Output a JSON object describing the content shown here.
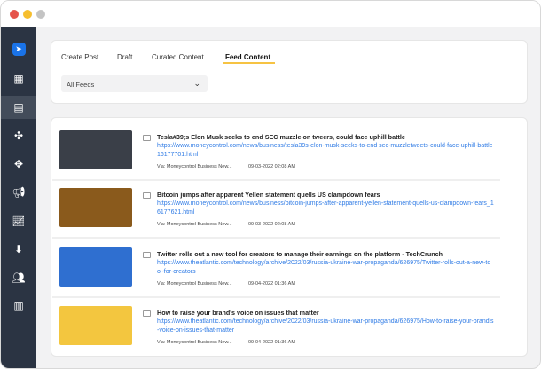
{
  "window": {
    "controls": [
      "close",
      "minimize",
      "maximize"
    ]
  },
  "sidebar": {
    "items": [
      "send-logo",
      "dashboard",
      "posts",
      "network",
      "move",
      "campaign",
      "analytics",
      "inbox",
      "users",
      "library"
    ]
  },
  "tabs": [
    {
      "label": "Create Post"
    },
    {
      "label": "Draft"
    },
    {
      "label": "Curated Content"
    },
    {
      "label": "Feed Content"
    }
  ],
  "filter": {
    "value": "All Feeds"
  },
  "feeds": [
    {
      "title": "Tesla#39;s Elon Musk seeks to end SEC muzzle on tweers, could face uphill battle",
      "url": "https://www.moneycontrol.com/news/business/tesla39s-elon-musk-seeks-to-end sec-muzzletweets-could-face-uphill-battle16177701.html",
      "via": "Via: Moneycontrol Business New...",
      "date": "09-03-2022 02:08 AM",
      "thumb": "#3a3f48"
    },
    {
      "title": "Bitcoin jumps after apparent Yellen statement quells US clampdown fears",
      "url": "https://www.moneycontrol.com/news/business/bitcoin-jumps-after-apparent-yellen-statement-quells-us-clampdown-fears_16177621.html",
      "via": "Via: Moneycontrol Business New...",
      "date": "09-03-2022 02:08 AM",
      "thumb": "#8a5a1c"
    },
    {
      "title": "Twitter rolls out a new tool for creators to manage their earnings on the platform - TechCrunch",
      "url": "https://www.theatlantic.com/technology/archive/2022/03/russia-ukraine-war-propaganda/626975/Twitter-rolls-out-a-new-tool-for-creators",
      "via": "Via: Moneycontrol Business New...",
      "date": "09-04-2022 01:36 AM",
      "thumb": "#2f6fd0"
    },
    {
      "title": "How to raise your brand's voice on issues that matter",
      "url": "https://www.theatlantic.com/technology/archive/2022/03/russia-ukraine-war-propaganda/626975/How-to-raise-your-brand's-voice-on-issues-that-matter",
      "via": "Via: Moneycontrol Business New...",
      "date": "09-04-2022 01:36 AM",
      "thumb": "#f3c63f"
    }
  ]
}
